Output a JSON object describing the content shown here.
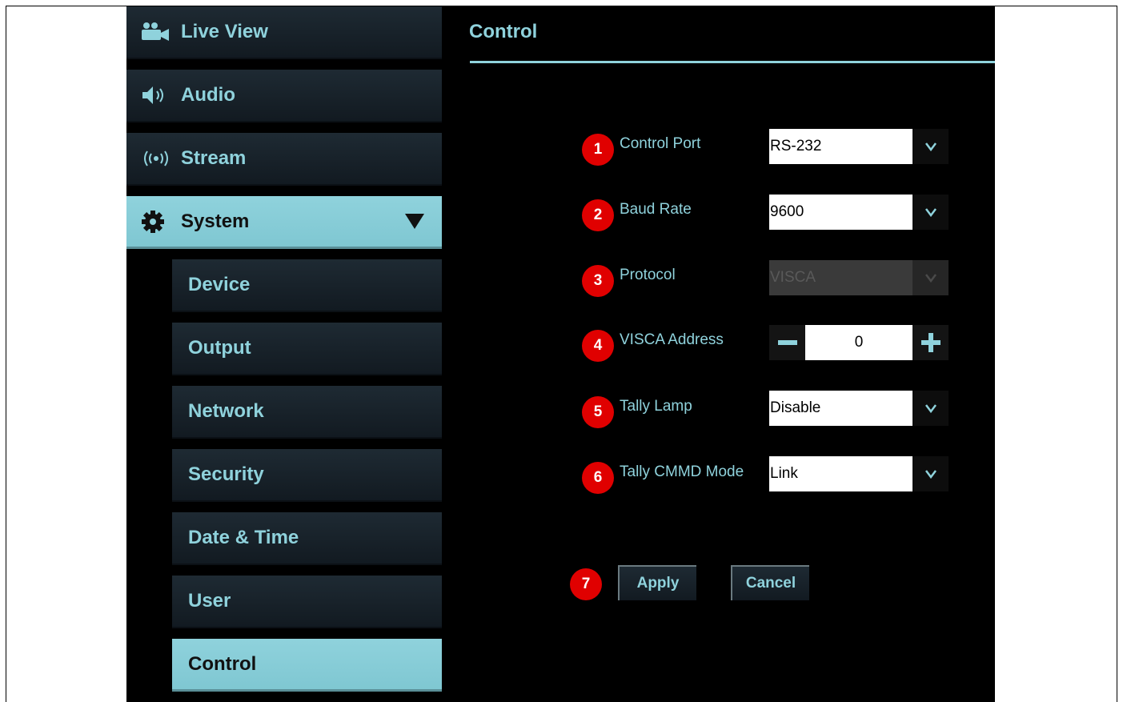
{
  "sidebar": {
    "items": [
      {
        "label": "Live View",
        "icon": "camera-users-icon"
      },
      {
        "label": "Audio",
        "icon": "speaker-icon"
      },
      {
        "label": "Stream",
        "icon": "broadcast-icon"
      },
      {
        "label": "System",
        "icon": "gear-icon",
        "expanded": true
      }
    ],
    "subitems": [
      {
        "label": "Device"
      },
      {
        "label": "Output"
      },
      {
        "label": "Network"
      },
      {
        "label": "Security"
      },
      {
        "label": "Date & Time"
      },
      {
        "label": "User"
      },
      {
        "label": "Control",
        "active": true
      }
    ]
  },
  "content": {
    "title": "Control",
    "fields": {
      "control_port": {
        "number": "1",
        "label": "Control Port",
        "value": "RS-232"
      },
      "baud_rate": {
        "number": "2",
        "label": "Baud Rate",
        "value": "9600"
      },
      "protocol": {
        "number": "3",
        "label": "Protocol",
        "value": "VISCA",
        "disabled": true
      },
      "visca_address": {
        "number": "4",
        "label": "VISCA Address",
        "value": "0"
      },
      "tally_lamp": {
        "number": "5",
        "label": "Tally Lamp",
        "value": "Disable"
      },
      "tally_cmmd_mode": {
        "number": "6",
        "label": "Tally CMMD Mode",
        "value": "Link"
      }
    },
    "actions": {
      "number": "7",
      "apply_label": "Apply",
      "cancel_label": "Cancel"
    }
  },
  "colors": {
    "accent": "#8fd2dc",
    "badge": "#e00000",
    "background": "#000000"
  }
}
